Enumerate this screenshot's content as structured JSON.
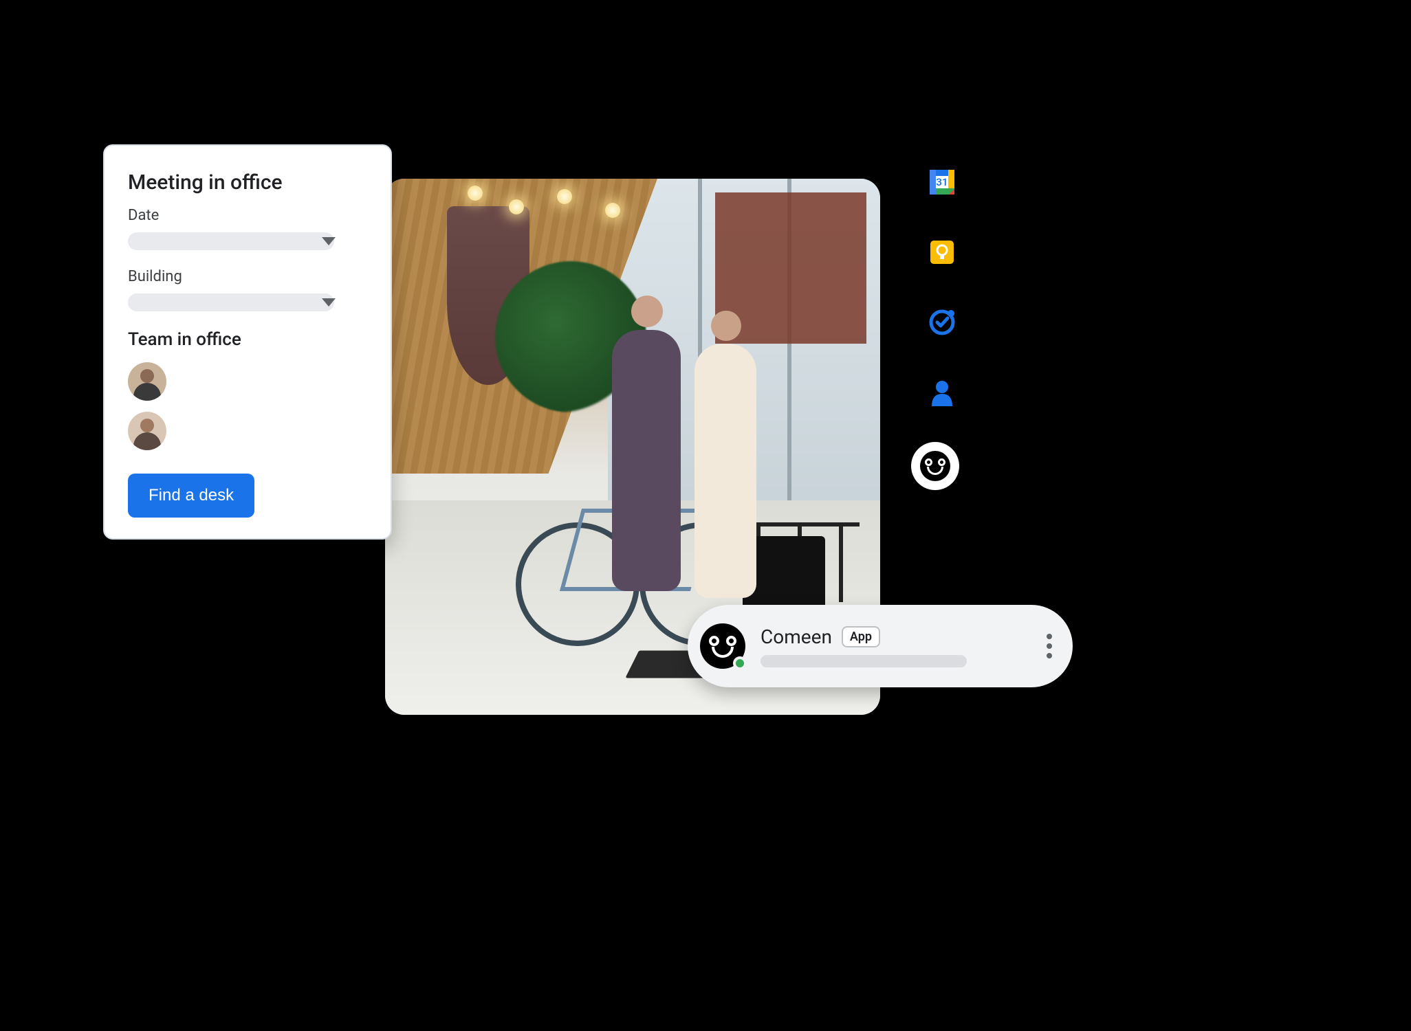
{
  "card": {
    "title": "Meeting in office",
    "date_label": "Date",
    "building_label": "Building",
    "team_heading": "Team in office",
    "button": "Find a desk"
  },
  "chat": {
    "name": "Comeen",
    "badge": "App"
  },
  "sidepanel": {
    "calendar_day": "31"
  }
}
